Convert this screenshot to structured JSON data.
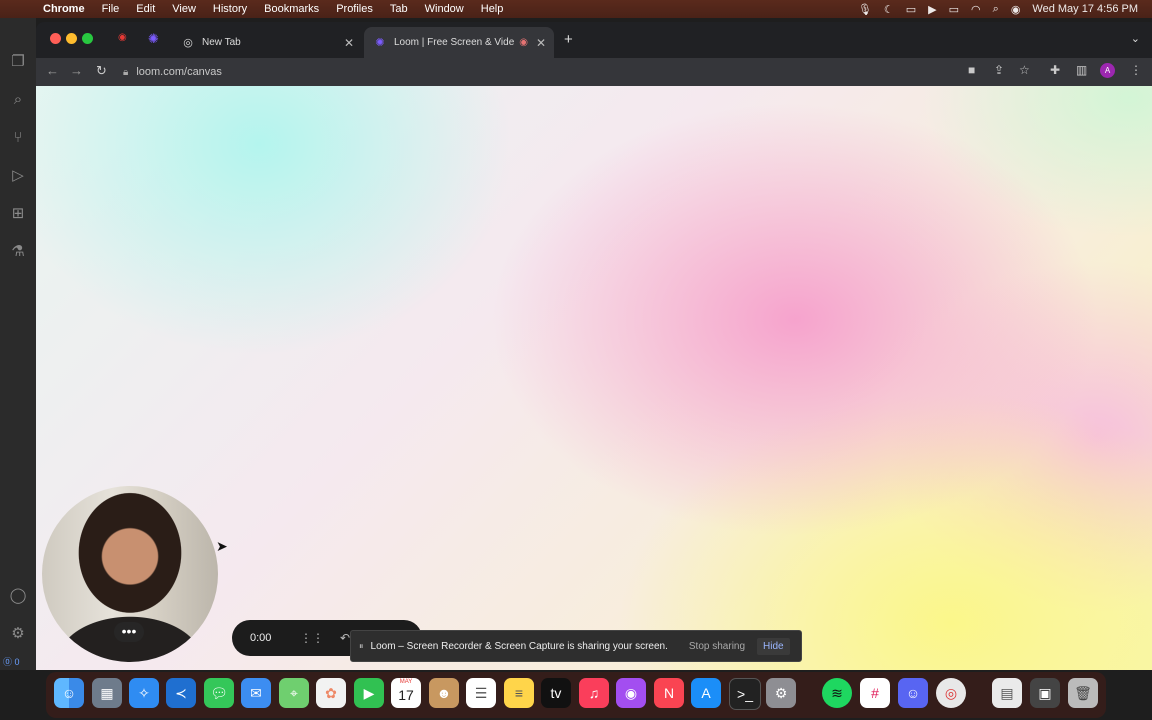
{
  "menubar": {
    "app": "Chrome",
    "items": [
      "File",
      "Edit",
      "View",
      "History",
      "Bookmarks",
      "Profiles",
      "Tab",
      "Window",
      "Help"
    ],
    "clock": "Wed May 17  4:56 PM"
  },
  "tabs": [
    {
      "label": "New Tab",
      "active": false
    },
    {
      "label": "Loom | Free Screen & Vide",
      "active": true
    }
  ],
  "address": {
    "url": "loom.com/canvas"
  },
  "profile_initial": "A",
  "recorder": {
    "time": "0:00"
  },
  "share_notice": {
    "message": "Loom – Screen Recorder & Screen Capture is sharing your screen.",
    "stop_label": "Stop sharing",
    "hide_label": "Hide"
  },
  "vscode": {
    "status": "⓪ 0"
  },
  "calendar": {
    "month": "MAY",
    "day": "17"
  },
  "dock_apps": [
    "finder-icon",
    "launchpad-icon",
    "safari-icon",
    "vscode-icon",
    "messages-icon",
    "mail-icon",
    "maps-icon",
    "photos-icon",
    "facetime-icon",
    "calendar-icon",
    "contacts-icon",
    "reminders-icon",
    "notes-icon",
    "appletv-icon",
    "music-icon",
    "podcasts-icon",
    "news-icon",
    "appstore-icon",
    "terminal-icon",
    "settings-icon",
    "spotify-icon",
    "slack-icon",
    "discord-icon",
    "chrome-icon",
    "files-icon",
    "screenshot-icon",
    "trash-icon"
  ]
}
